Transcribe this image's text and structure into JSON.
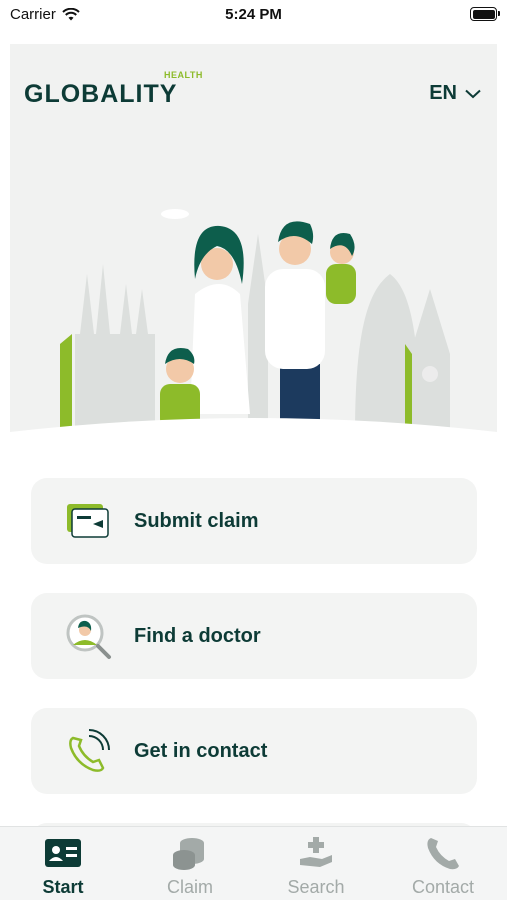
{
  "status_bar": {
    "carrier": "Carrier",
    "time": "5:24 PM"
  },
  "header": {
    "logo_text": "GLOBALITY",
    "logo_sub": "HEALTH",
    "language": "EN"
  },
  "actions": [
    {
      "label": "Submit claim",
      "icon": "claim-card-icon"
    },
    {
      "label": "Find a doctor",
      "icon": "doctor-search-icon"
    },
    {
      "label": "Get in contact",
      "icon": "phone-icon"
    }
  ],
  "tabs": [
    {
      "label": "Start",
      "icon": "id-card-icon",
      "active": true
    },
    {
      "label": "Claim",
      "icon": "coins-icon",
      "active": false
    },
    {
      "label": "Search",
      "icon": "hand-plus-icon",
      "active": false
    },
    {
      "label": "Contact",
      "icon": "phone-icon",
      "active": false
    }
  ],
  "colors": {
    "brand_dark": "#0d3b36",
    "brand_green": "#8dbb2a",
    "card_bg": "#f3f4f3",
    "inactive": "#a3aaa8"
  }
}
